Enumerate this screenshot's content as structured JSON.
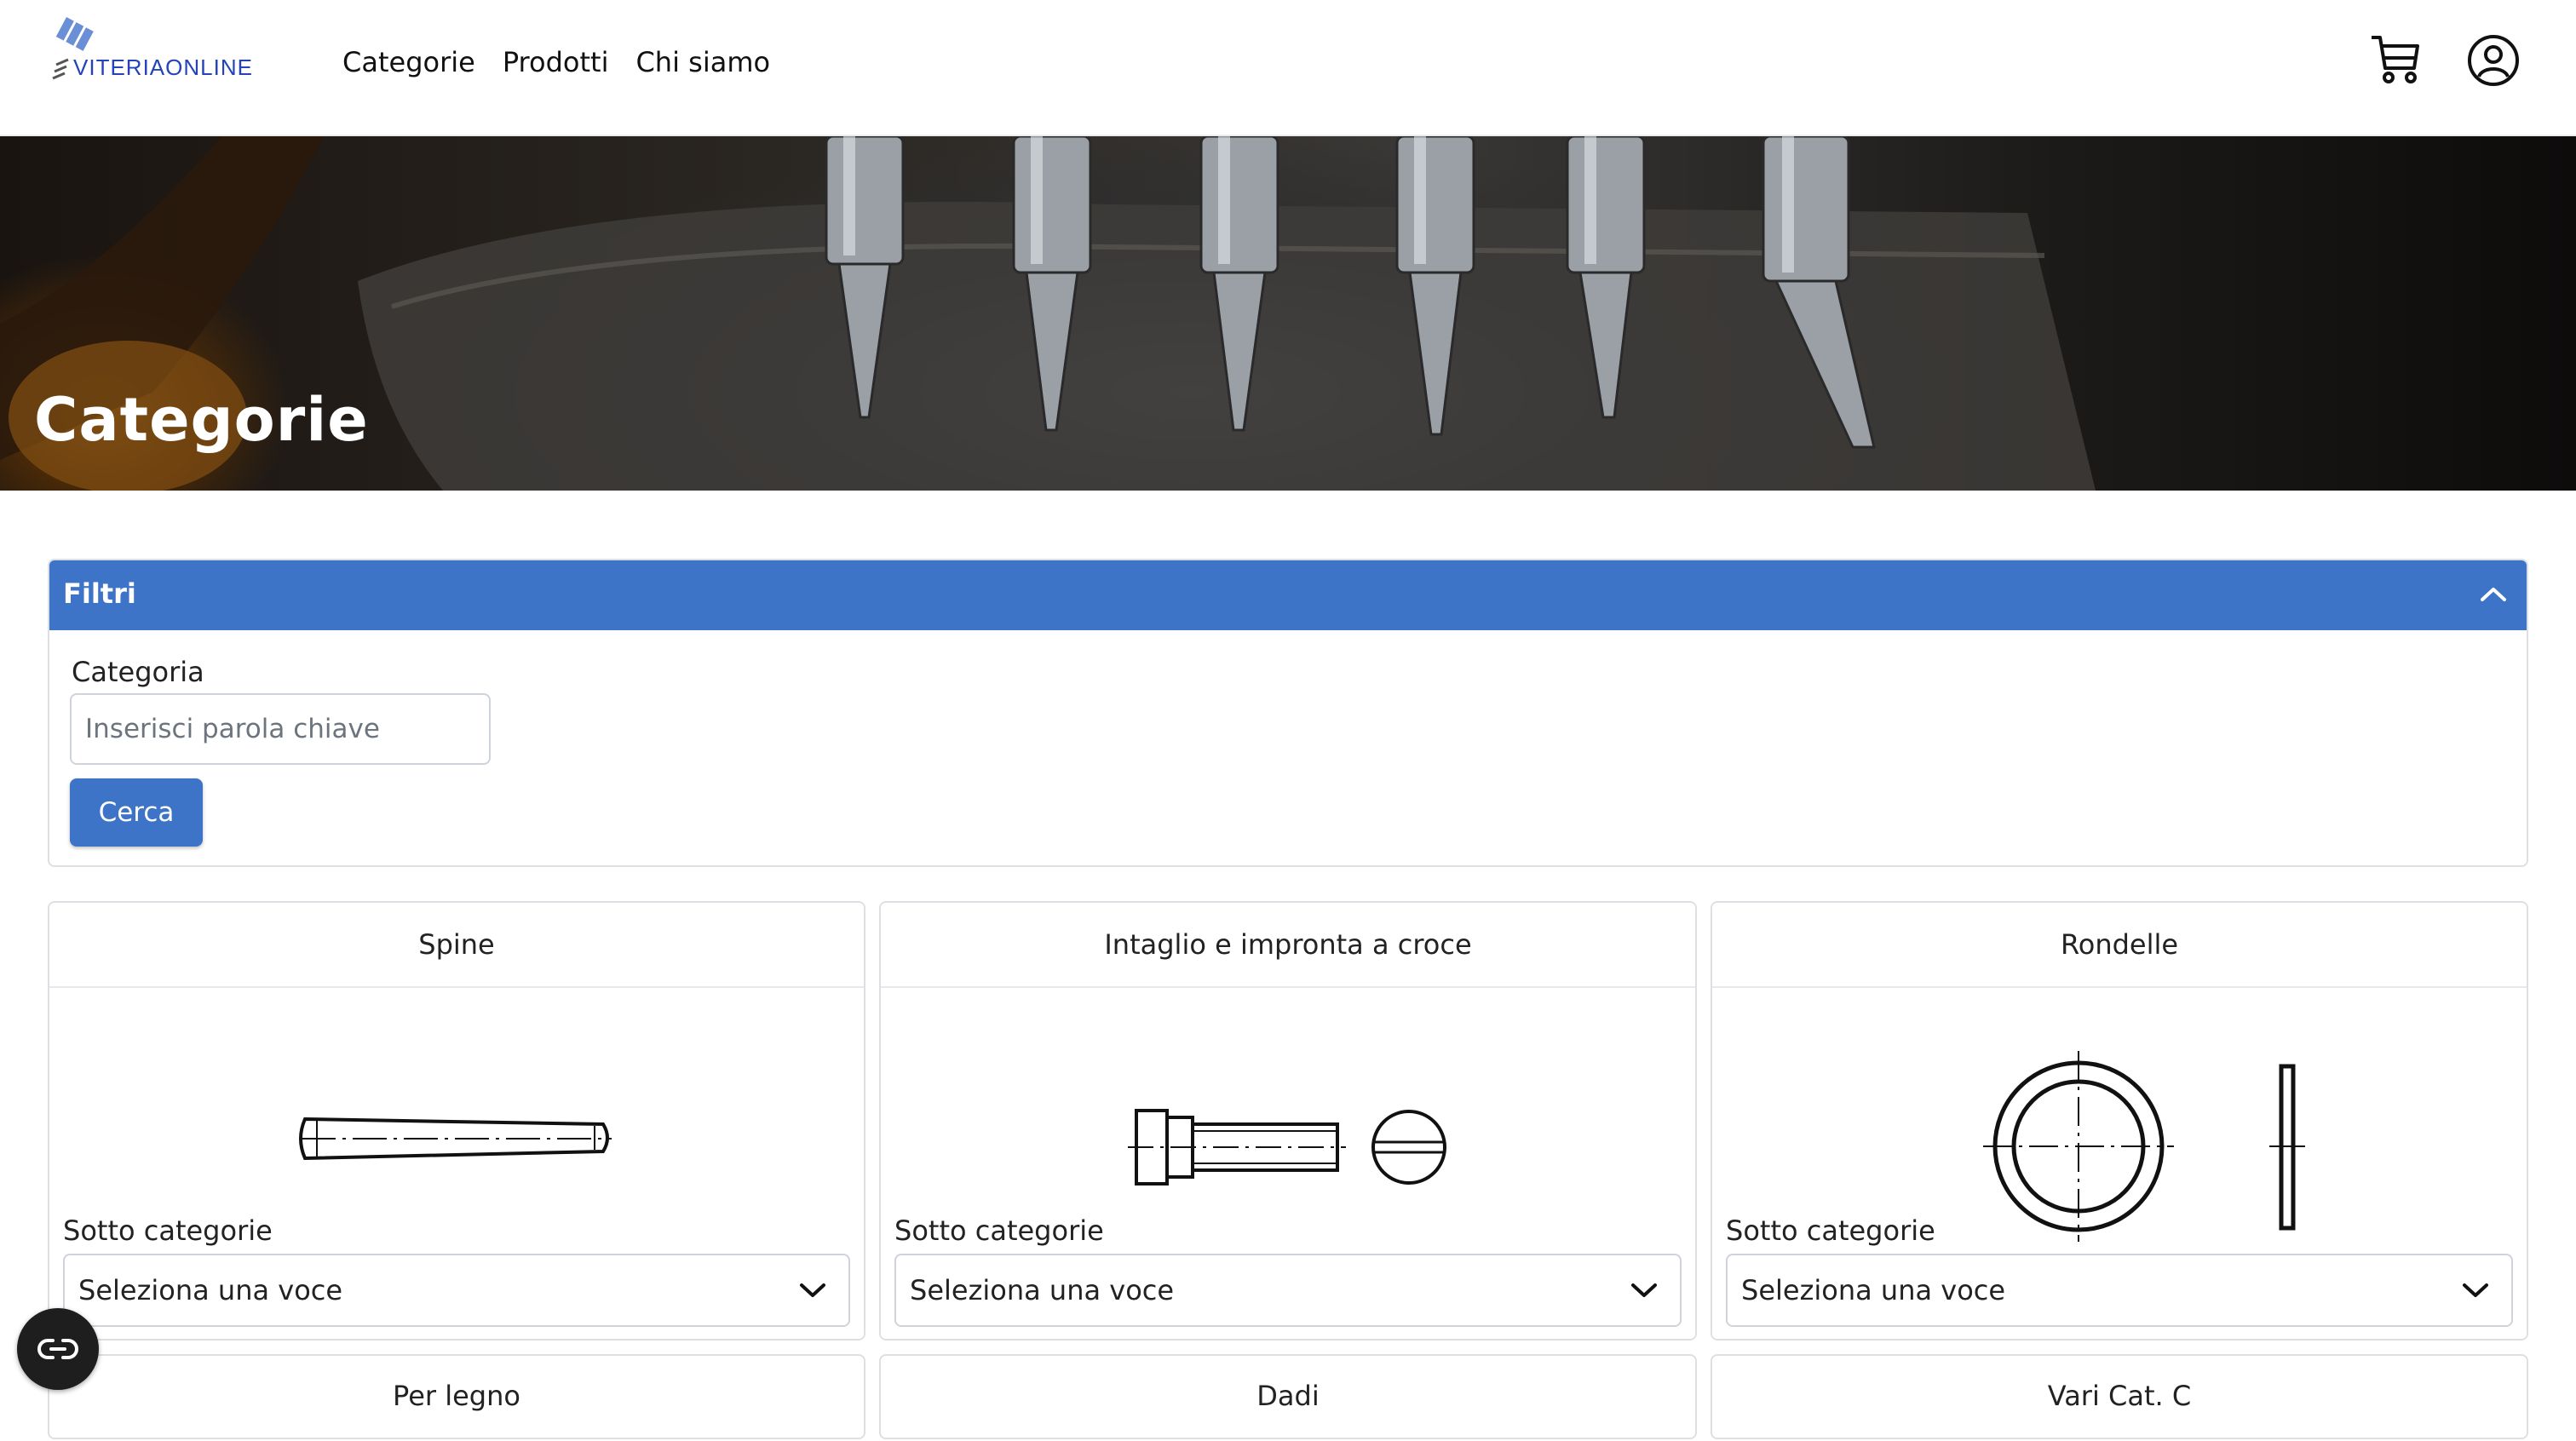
{
  "header": {
    "logo_text": "VITERIAONLINE",
    "nav": [
      {
        "label": "Categorie"
      },
      {
        "label": "Prodotti"
      },
      {
        "label": "Chi siamo"
      }
    ],
    "icons": [
      "cart-icon",
      "user-icon"
    ]
  },
  "hero": {
    "title": "Categorie"
  },
  "filters": {
    "title": "Filtri",
    "category_label": "Categoria",
    "keyword_placeholder": "Inserisci parola chiave",
    "keyword_value": "",
    "search_label": "Cerca",
    "header_color": "#3d74c7"
  },
  "cards": [
    {
      "title": "Spine",
      "sub_label": "Sotto categorie",
      "select_value": "Seleziona una voce"
    },
    {
      "title": "Intaglio e impronta a croce",
      "sub_label": "Sotto categorie",
      "select_value": "Seleziona una voce"
    },
    {
      "title": "Rondelle",
      "sub_label": "Sotto categorie",
      "select_value": "Seleziona una voce"
    },
    {
      "title": "Per legno"
    },
    {
      "title": "Dadi"
    },
    {
      "title": "Vari Cat. C"
    }
  ],
  "accessibility": {
    "icon": "accessibility-icon"
  }
}
